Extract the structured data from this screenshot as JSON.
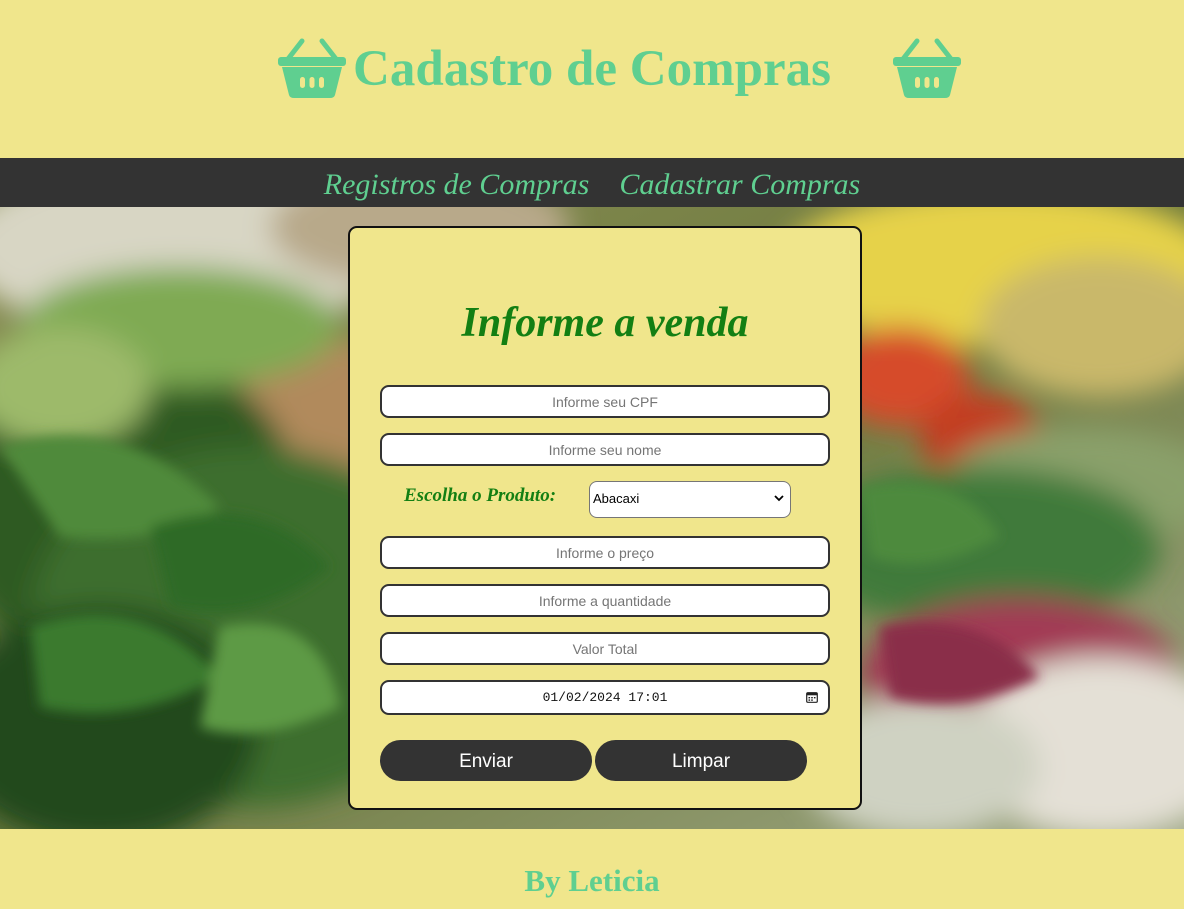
{
  "header": {
    "title": "Cadastro de Compras",
    "icon": "shopping-basket-icon"
  },
  "nav": {
    "items": [
      {
        "label": "Registros de Compras"
      },
      {
        "label": "Cadastrar Compras"
      }
    ]
  },
  "form": {
    "title": "Informe a venda",
    "cpf_placeholder": "Informe seu CPF",
    "nome_placeholder": "Informe seu nome",
    "produto_label": "Escolha o Produto:",
    "produto_selected": "Abacaxi",
    "preco_placeholder": "Informe o preço",
    "quantidade_placeholder": "Informe a quantidade",
    "total_placeholder": "Valor Total",
    "datetime_value": "01/02/2024 17:01",
    "submit_label": "Enviar",
    "reset_label": "Limpar"
  },
  "footer": {
    "text": "By Leticia"
  },
  "colors": {
    "background": "#F0E68C",
    "accent": "#5FCF90",
    "nav_bg": "#333333",
    "form_title": "#137F13"
  }
}
